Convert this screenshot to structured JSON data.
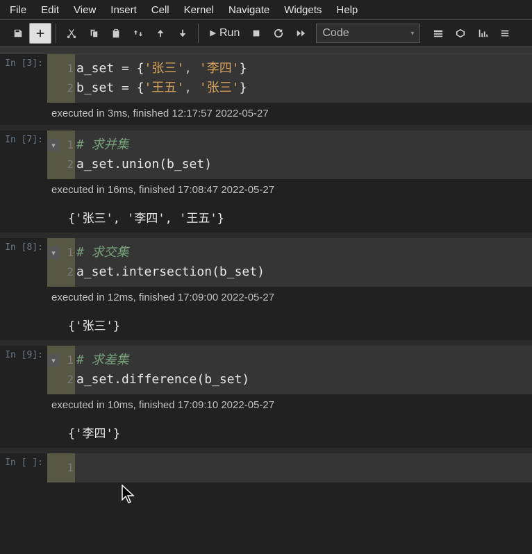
{
  "menu": [
    "File",
    "Edit",
    "View",
    "Insert",
    "Cell",
    "Kernel",
    "Navigate",
    "Widgets",
    "Help"
  ],
  "toolbar": {
    "run_label": "Run",
    "cell_type": "Code"
  },
  "cells": [
    {
      "prompt": "In [3]:",
      "lines": [
        "1",
        "2"
      ],
      "exec": "executed in 3ms, finished 12:17:57 2022-05-27"
    },
    {
      "prompt": "In [7]:",
      "lines": [
        "1",
        "2"
      ],
      "exec": "executed in 16ms, finished 17:08:47 2022-05-27",
      "output": "{'张三', '李四', '王五'}"
    },
    {
      "prompt": "In [8]:",
      "lines": [
        "1",
        "2"
      ],
      "exec": "executed in 12ms, finished 17:09:00 2022-05-27",
      "output": "{'张三'}"
    },
    {
      "prompt": "In [9]:",
      "lines": [
        "1",
        "2"
      ],
      "exec": "executed in 10ms, finished 17:09:10 2022-05-27",
      "output": "{'李四'}"
    },
    {
      "prompt": "In [ ]:",
      "lines": [
        "1"
      ]
    }
  ],
  "code": {
    "c0l1a": "a_set ",
    "c0l1b": "= {",
    "c0l1s1": "'张三'",
    "c0l1c": ", ",
    "c0l1s2": "'李四'",
    "c0l1d": "}",
    "c0l2a": "b_set ",
    "c0l2b": "= {",
    "c0l2s1": "'王五'",
    "c0l2c": ", ",
    "c0l2s2": "'张三'",
    "c0l2d": "}",
    "c1l1": "# 求并集",
    "c1l2": "a_set.union(b_set)",
    "c2l1": "# 求交集",
    "c2l2": "a_set.intersection(b_set)",
    "c3l1": "# 求差集",
    "c3l2": "a_set.difference(b_set)"
  }
}
